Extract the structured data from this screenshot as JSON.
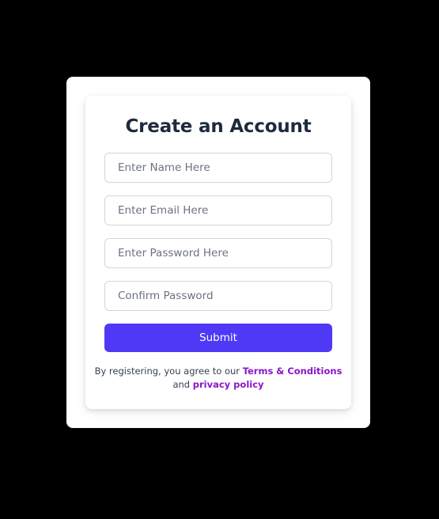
{
  "form": {
    "title": "Create an Account",
    "fields": [
      {
        "placeholder": "Enter Name Here",
        "value": ""
      },
      {
        "placeholder": "Enter Email Here",
        "value": ""
      },
      {
        "placeholder": "Enter Password Here",
        "value": ""
      },
      {
        "placeholder": "Confirm Password",
        "value": ""
      }
    ],
    "submit_label": "Submit"
  },
  "terms": {
    "prefix": "By registering, you agree to our ",
    "terms_link": "Terms & Conditions",
    "joiner": " and ",
    "privacy_link": "privacy policy"
  },
  "colors": {
    "background": "#000000",
    "card": "#ffffff",
    "title": "#1f2a3d",
    "button": "#4f39f6",
    "link": "#8a16c9"
  }
}
